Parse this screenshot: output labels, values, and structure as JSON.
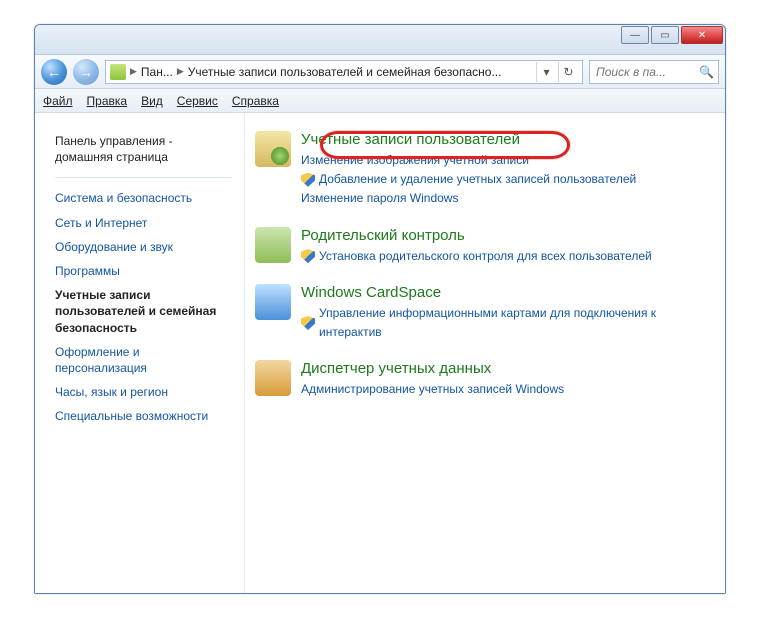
{
  "breadcrumb": {
    "root": "Пан...",
    "current": "Учетные записи пользователей и семейная безопасно..."
  },
  "search": {
    "placeholder": "Поиск в па..."
  },
  "menu": {
    "file": "Файл",
    "edit": "Правка",
    "view": "Вид",
    "tools": "Сервис",
    "help": "Справка"
  },
  "sidebar": {
    "home": "Панель управления - домашняя страница",
    "items": [
      "Система и безопасность",
      "Сеть и Интернет",
      "Оборудование и звук",
      "Программы"
    ],
    "current": "Учетные записи пользователей и семейная безопасность",
    "items2": [
      "Оформление и персонализация",
      "Часы, язык и регион",
      "Специальные возможности"
    ]
  },
  "sections": {
    "user_accounts": {
      "title": "Учетные записи пользователей",
      "change_image": "Изменение изображения учетной записи",
      "add_remove": "Добавление и удаление учетных записей пользователей",
      "change_pwd": "Изменение пароля Windows"
    },
    "parental": {
      "title": "Родительский контроль",
      "setup": "Установка родительского контроля для всех пользователей"
    },
    "cardspace": {
      "title": "Windows CardSpace",
      "manage": "Управление информационными картами для подключения к интерактив"
    },
    "credentials": {
      "title": "Диспетчер учетных данных",
      "admin": "Администрирование учетных записей Windows"
    }
  }
}
